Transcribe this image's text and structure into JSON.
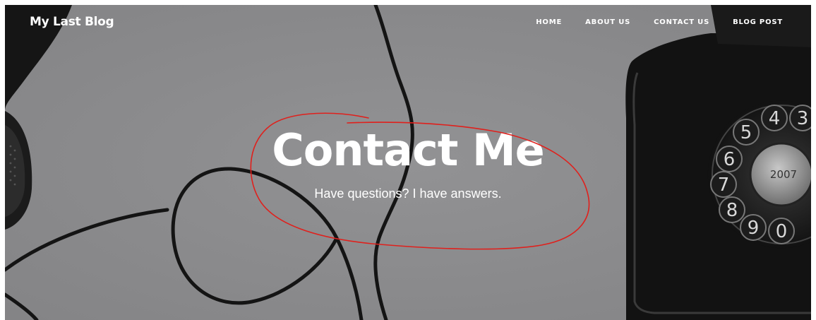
{
  "navbar": {
    "brand": "My Last Blog",
    "links": [
      "HOME",
      "ABOUT US",
      "CONTACT US",
      "BLOG POST"
    ]
  },
  "hero": {
    "title": "Contact Me",
    "subtitle": "Have questions? I have answers.",
    "background_image": "rotary-telephone-with-cord-grayscale"
  },
  "annotation": {
    "type": "red-hand-drawn-ellipse",
    "color": "#e0201c"
  },
  "dial": {
    "digits": [
      "5",
      "4",
      "3",
      "6",
      "7",
      "8",
      "9",
      "0"
    ],
    "center_text": "2007"
  }
}
